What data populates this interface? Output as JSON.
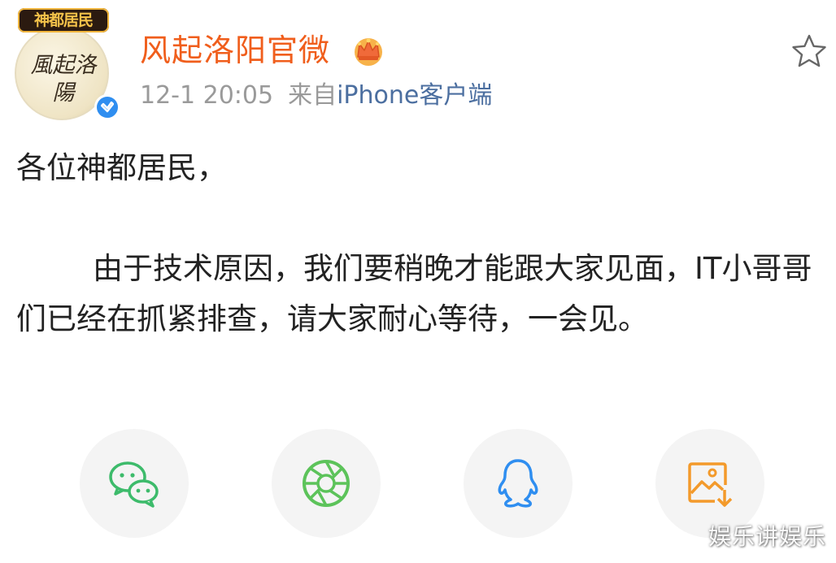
{
  "avatar": {
    "banner_text": "神都居民",
    "calligraphy_text": "風起洛陽"
  },
  "header": {
    "username": "风起洛阳官微",
    "timestamp": "12-1 20:05",
    "source_prefix": "来自",
    "source_device": "iPhone客户端"
  },
  "post": {
    "greeting": "各位神都居民，",
    "body": "由于技术原因，我们要稍晚才能跟大家见面，IT小哥哥们已经在抓紧排查，请大家耐心等待，一会见。"
  },
  "share": {
    "items": [
      "wechat-icon",
      "moments-icon",
      "qq-icon",
      "save-image-icon"
    ]
  },
  "colors": {
    "username": "#f05e1c",
    "verified": "#2f8ef0",
    "wechat": "#3dbb6b",
    "moments": "#5cc35a",
    "qq": "#2f8ef0",
    "save": "#f39a2b"
  },
  "watermark": "娱乐讲娱乐"
}
